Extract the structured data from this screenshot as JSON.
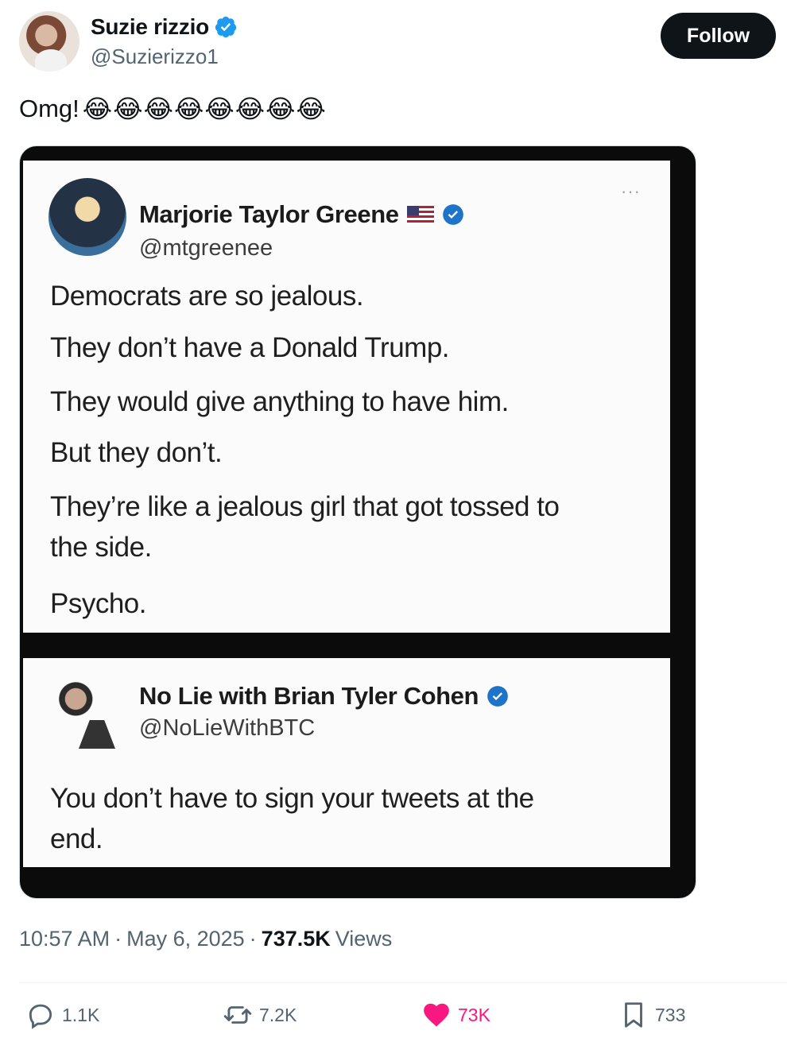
{
  "author": {
    "name": "Suzie rizzio",
    "handle": "@Suzierizzo1",
    "follow_label": "Follow",
    "verified_color": "#1d9bf0"
  },
  "tweet": {
    "text": "Omg!",
    "emoji": "😂😂😂😂😂😂😂😂"
  },
  "embedded": {
    "post1": {
      "name": "Marjorie Taylor Greene",
      "handle": "@mtgreenee",
      "more": "···",
      "lines": [
        "Democrats are so jealous.",
        "They don’t have a Donald Trump.",
        "They would give anything to have him.",
        "But they don’t.",
        "They’re like a jealous girl that got tossed to",
        "the side.",
        "Psycho."
      ]
    },
    "post2": {
      "name": "No Lie with Brian Tyler Cohen",
      "handle": "@NoLieWithBTC",
      "lines": [
        "You don’t have to sign your tweets at the",
        "end."
      ]
    }
  },
  "meta": {
    "time": "10:57 AM",
    "sep1": "·",
    "date": "May 6, 2025",
    "sep2": "·",
    "views_count": "737.5K",
    "views_label": "Views"
  },
  "actions": {
    "replies": "1.1K",
    "reposts": "7.2K",
    "likes": "73K",
    "bookmarks": "733",
    "like_color": "#f91880"
  }
}
